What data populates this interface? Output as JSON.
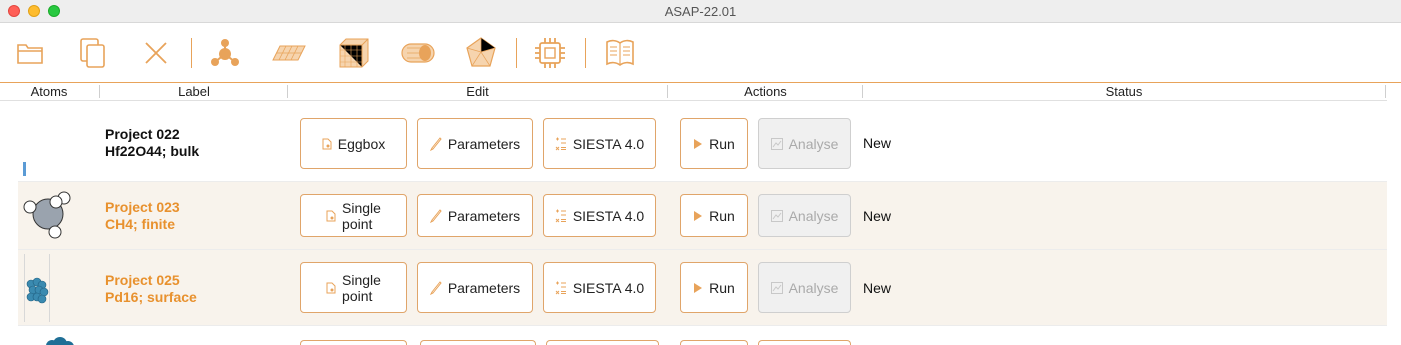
{
  "window": {
    "title": "ASAP-22.01"
  },
  "toolbar": {
    "items": [
      {
        "icon": "open-folder-icon"
      },
      {
        "icon": "copy-icon"
      },
      {
        "icon": "delete-x-icon"
      },
      {
        "icon": "molecule-icon"
      },
      {
        "icon": "slab-icon"
      },
      {
        "icon": "crystal-icon"
      },
      {
        "icon": "tube-icon"
      },
      {
        "icon": "polyhedron-icon"
      },
      {
        "icon": "chip-icon"
      },
      {
        "icon": "book-icon"
      }
    ],
    "accent": "#e8a35a"
  },
  "table": {
    "headers": {
      "atoms": "Atoms",
      "label": "Label",
      "edit": "Edit",
      "actions": "Actions",
      "status": "Status"
    },
    "rows": [
      {
        "project": "Project 022",
        "system": "Hf22O44; bulk",
        "label_color": "#111111",
        "task": "Eggbox",
        "task_two_line": false,
        "params": "Parameters",
        "code": "SIESTA 4.0",
        "run": "Run",
        "analyse": "Analyse",
        "status": "New",
        "thumb": "bulk-structure"
      },
      {
        "project": "Project 023",
        "system": "CH4; finite",
        "label_color": "#e8912e",
        "task_line1": "Single",
        "task_line2": "point",
        "task_two_line": true,
        "params": "Parameters",
        "code": "SIESTA 4.0",
        "run": "Run",
        "analyse": "Analyse",
        "status": "New",
        "thumb": "molecule-structure"
      },
      {
        "project": "Project 025",
        "system": "Pd16; surface",
        "label_color": "#e8912e",
        "task_line1": "Single",
        "task_line2": "point",
        "task_two_line": true,
        "params": "Parameters",
        "code": "SIESTA 4.0",
        "run": "Run",
        "analyse": "Analyse",
        "status": "New",
        "thumb": "surface-structure"
      }
    ]
  }
}
